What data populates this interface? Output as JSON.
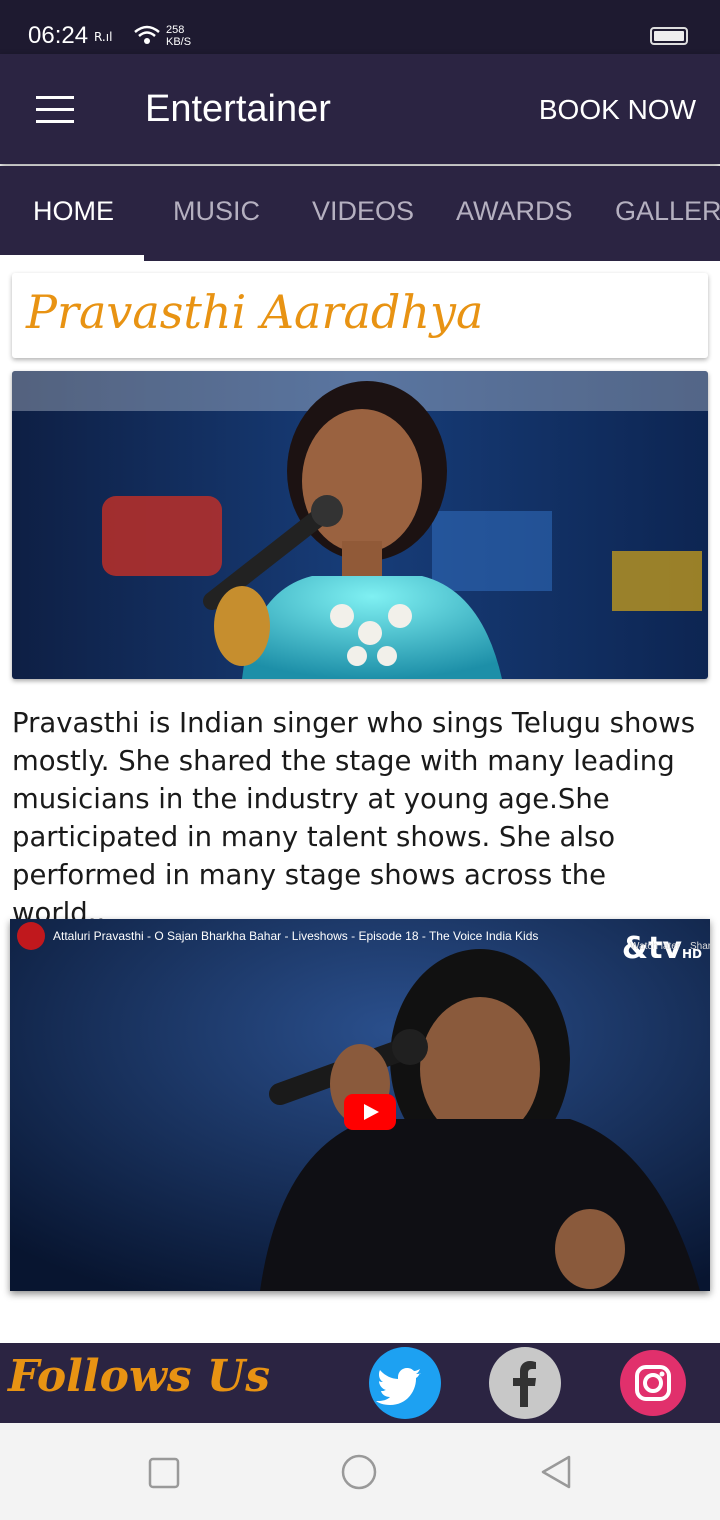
{
  "status": {
    "time": "06:24",
    "signal": "R",
    "speed_value": "258",
    "speed_unit": "KB/S"
  },
  "app_bar": {
    "title": "Entertainer",
    "book_now": "BOOK NOW"
  },
  "tabs": [
    {
      "label": "HOME"
    },
    {
      "label": "MUSIC"
    },
    {
      "label": "VIDEOS"
    },
    {
      "label": "AWARDS"
    },
    {
      "label": "GALLERY"
    }
  ],
  "artist": {
    "name": "Pravasthi Aaradhya",
    "bio": "Pravasthi is Indian singer who sings Telugu shows mostly. She shared the stage with many leading musicians in the industry at young age.She participated in many talent shows. She also performed in many stage shows across the world.."
  },
  "video": {
    "title": "Attaluri Pravasthi - O Sajan Bharkha Bahar - Liveshows - Episode 18 - The Voice India Kids",
    "channel_logo": "&tv",
    "channel_logo_tag": "HD",
    "watch_later": "Watch later",
    "share": "Share"
  },
  "footer": {
    "follow_label": "Follows Us"
  },
  "social": [
    {
      "name": "twitter-icon",
      "color": "#1da1f2"
    },
    {
      "name": "facebook-icon",
      "color": "#c8c8c8"
    },
    {
      "name": "instagram-icon",
      "color": "#e1306c"
    }
  ],
  "colors": {
    "primary": "#2b2442",
    "accent": "#e89313"
  }
}
